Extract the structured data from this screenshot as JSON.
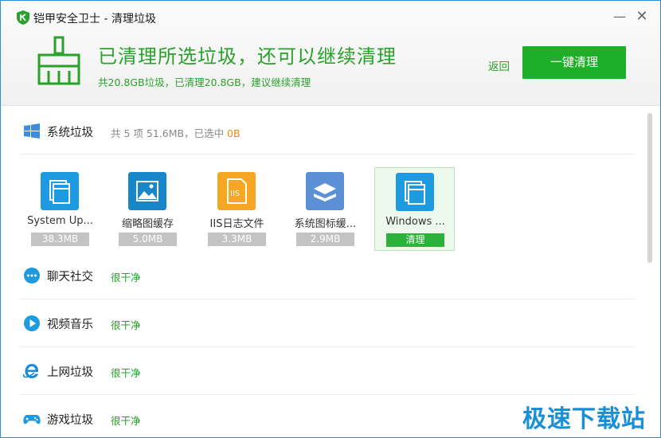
{
  "window": {
    "title": "铠甲安全卫士 - 清理垃圾",
    "minimize": "—",
    "close": "✕"
  },
  "header": {
    "status_title": "已清理所选垃圾，还可以继续清理",
    "status_sub": "共20.8GB垃圾，已清理20.8GB，建议继续清理",
    "back_label": "返回",
    "clean_button_label": "一键清理"
  },
  "colors": {
    "accent_green": "#1fae27",
    "text_green": "#2aa12a",
    "highlight_orange": "#f08c00",
    "window_border": "#2f8fd6"
  },
  "system_junk": {
    "name": "系统垃圾",
    "icon": "windows-logo-icon",
    "stat_prefix": "共 5 项 51.6MB，已选中 ",
    "stat_selected": "0B",
    "tiles": [
      {
        "label": "System Up...",
        "size": "38.3MB",
        "icon": "window-stack-icon",
        "color": "#1e9be0"
      },
      {
        "label": "缩略图缓存",
        "size": "5.0MB",
        "icon": "image-icon",
        "color": "#1787c9"
      },
      {
        "label": "IIS日志文件",
        "size": "3.3MB",
        "icon": "iis-log-icon",
        "color": "#f5a623"
      },
      {
        "label": "系统图标缓...",
        "size": "2.9MB",
        "icon": "layers-icon",
        "color": "#5b8fd6"
      },
      {
        "label": "Windows ...",
        "size": "清理",
        "icon": "window-stack-icon",
        "color": "#1e9be0",
        "selected": true
      }
    ]
  },
  "categories": [
    {
      "name": "聊天社交",
      "status": "很干净",
      "icon": "chat-bubble-icon"
    },
    {
      "name": "视频音乐",
      "status": "很干净",
      "icon": "play-icon"
    },
    {
      "name": "上网垃圾",
      "status": "很干净",
      "icon": "ie-browser-icon"
    },
    {
      "name": "游戏垃圾",
      "status": "很干净",
      "icon": "gamepad-icon"
    }
  ],
  "watermark": "极速下载站"
}
